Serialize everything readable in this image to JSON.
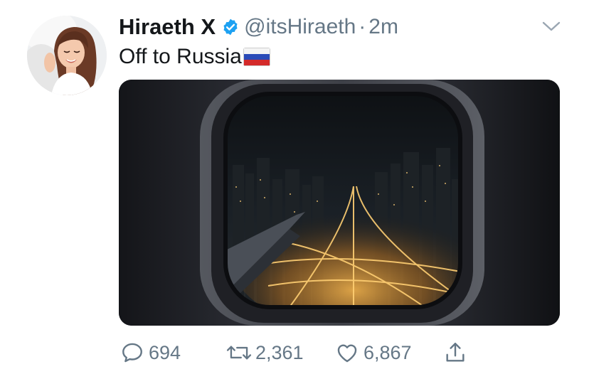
{
  "tweet": {
    "display_name": "Hiraeth X",
    "handle": "@itsHiraeth",
    "separator": "·",
    "time": "2m",
    "text": "Off to Russia",
    "flag_icon": "russia-flag-icon",
    "verified_icon": "verified-badge-icon"
  },
  "actions": {
    "reply_count": "694",
    "retweet_count": "2,361",
    "like_count": "6,867"
  },
  "colors": {
    "verified": "#1da1f2",
    "secondary_text": "#657786",
    "primary_text": "#14171a"
  }
}
